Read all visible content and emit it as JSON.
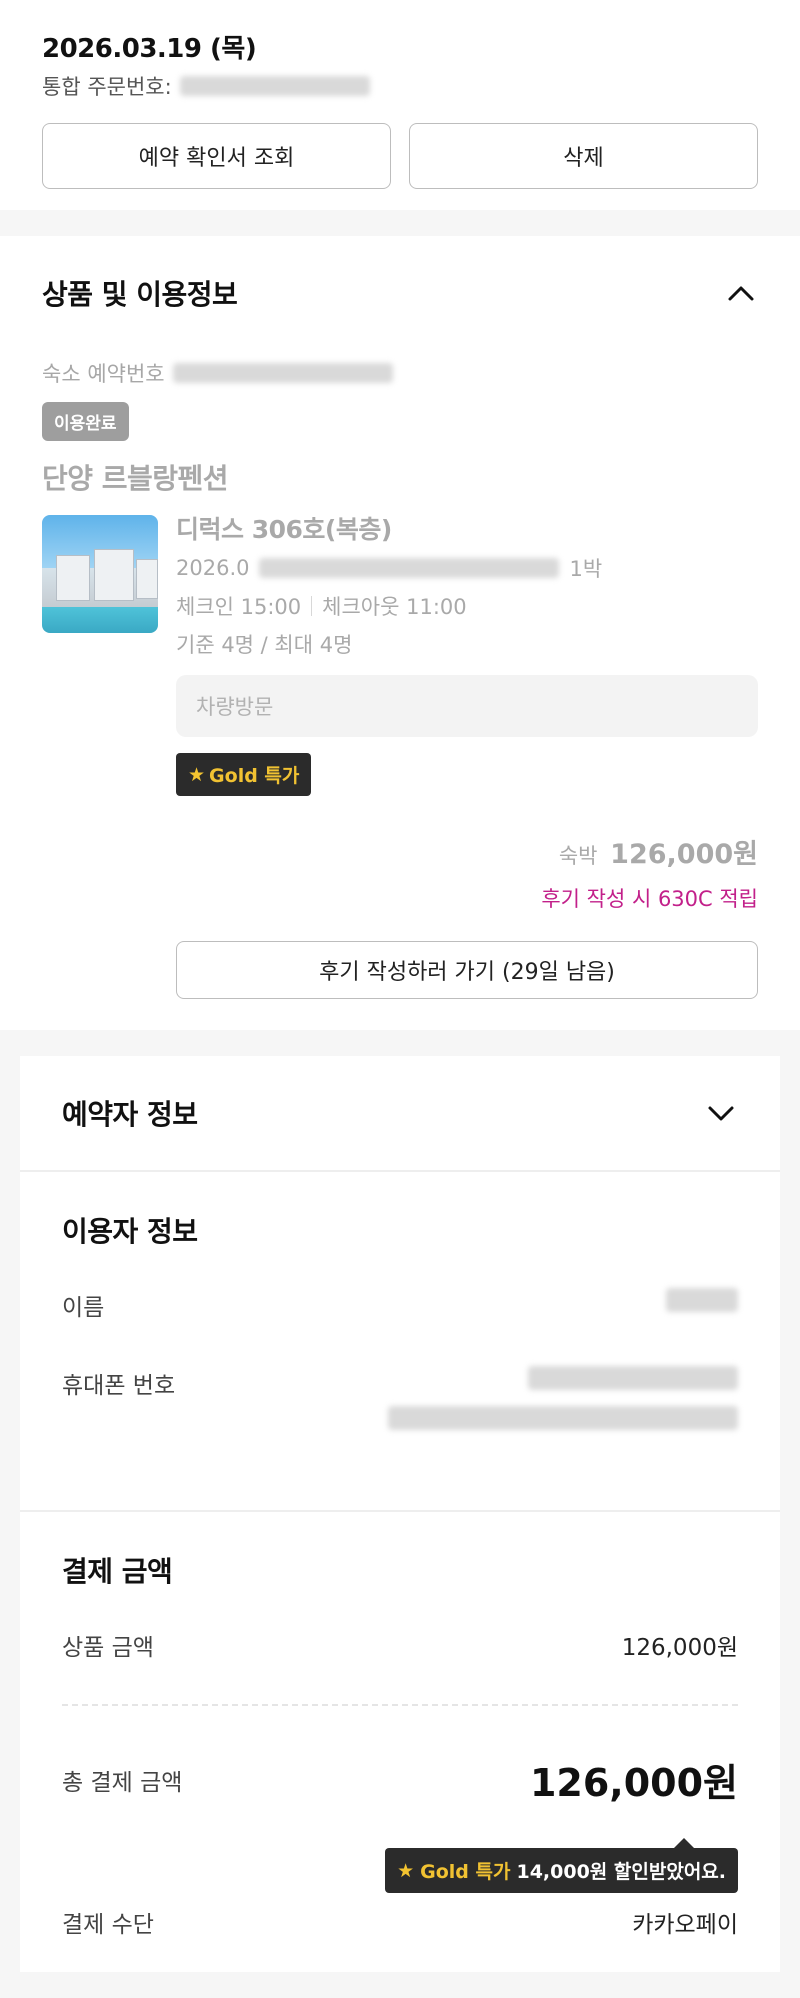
{
  "order": {
    "date": "2026.03.19 (목)",
    "order_no_label": "통합 주문번호:",
    "confirm_button": "예약 확인서 조회",
    "delete_button": "삭제"
  },
  "product": {
    "section_title": "상품 및 이용정보",
    "reservation_label": "숙소 예약번호",
    "status_badge": "이용완료",
    "hotel_name": "단양 르블랑펜션",
    "room_name": "디럭스 306호(복층)",
    "stay_date_prefix": "2026.0",
    "nights": "1박",
    "checkin": "체크인 15:00",
    "checkout": "체크아웃 11:00",
    "capacity": "기준 4명 / 최대 4명",
    "visit_method": "차량방문",
    "gold_badge": "Gold 특가",
    "price_label": "숙박",
    "price": "126,000원",
    "review_point": "후기 작성 시 630C 적립",
    "review_button": "후기 작성하러 가기 (29일 남음)"
  },
  "booker": {
    "title": "예약자 정보"
  },
  "user": {
    "title": "이용자 정보",
    "name_label": "이름",
    "phone_label": "휴대폰 번호"
  },
  "payment": {
    "title": "결제 금액",
    "product_amount_label": "상품 금액",
    "product_amount": "126,000원",
    "total_label": "총 결제 금액",
    "total_amount": "126,000원",
    "discount_gold": "Gold 특가",
    "discount_text": "14,000원 할인받았어요.",
    "method_label": "결제 수단",
    "method": "카카오페이"
  },
  "colors": {
    "accent_pink": "#c2208a",
    "gold": "#f1c232",
    "dark_badge": "#2b2b2b"
  }
}
